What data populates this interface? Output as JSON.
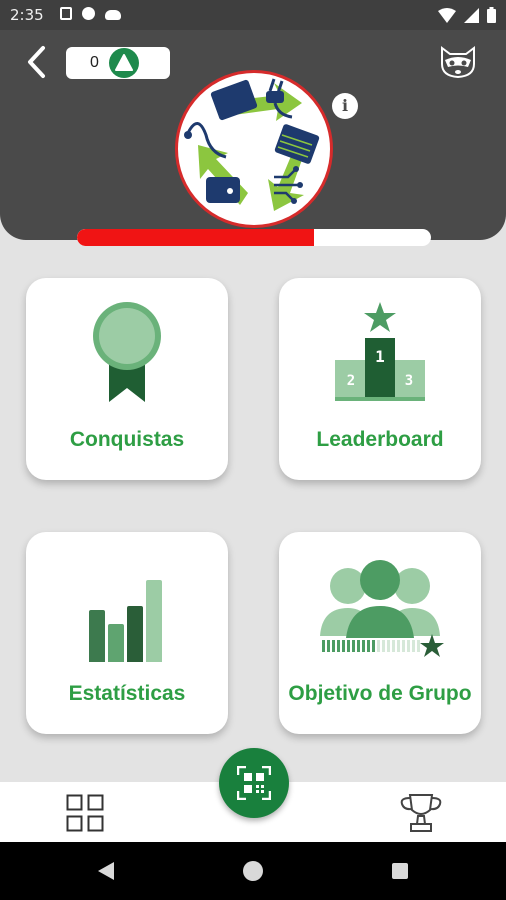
{
  "status_bar": {
    "time": "2:35",
    "left_icons": [
      "notification-square-icon",
      "data-saver-icon",
      "cloud-icon"
    ],
    "right_icons": [
      "wifi-icon",
      "signal-icon",
      "battery-icon"
    ]
  },
  "header": {
    "points_value": "0",
    "points_icon": "recycle-triangle-icon",
    "avatar_icon": "raccoon-icon",
    "logo_icon": "ewaste-recycle-logo",
    "info_label": "i",
    "level_progress": 0.67,
    "colors": {
      "background": "#4a4a4a",
      "progress": "#f01414"
    }
  },
  "cards": [
    {
      "label": "Conquistas",
      "icon": "medal-icon"
    },
    {
      "label": "Leaderboard",
      "icon": "podium-icon"
    },
    {
      "label": "Estatísticas",
      "icon": "bar-chart-icon"
    },
    {
      "label": "Objetivo de Grupo",
      "icon": "group-goal-icon"
    }
  ],
  "bottom_nav": {
    "left_icon": "dashboard-grid-icon",
    "center_icon": "qr-code-icon",
    "right_icon": "trophy-icon"
  },
  "colors": {
    "accent": "#2e9e44",
    "fab": "#19803d"
  }
}
